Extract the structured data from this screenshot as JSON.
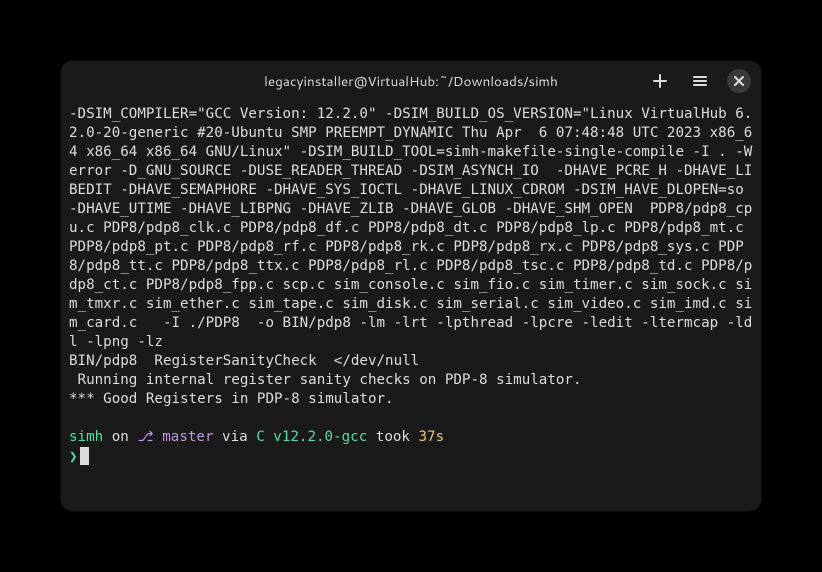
{
  "window": {
    "title": "legacyinstaller@VirtualHub:~/Downloads/simh"
  },
  "output": {
    "compile": "-DSIM_COMPILER=\"GCC Version: 12.2.0\" -DSIM_BUILD_OS_VERSION=\"Linux VirtualHub 6.2.0-20-generic #20-Ubuntu SMP PREEMPT_DYNAMIC Thu Apr  6 07:48:48 UTC 2023 x86_64 x86_64 x86_64 GNU/Linux\" -DSIM_BUILD_TOOL=simh-makefile-single-compile -I . -Werror -D_GNU_SOURCE -DUSE_READER_THREAD -DSIM_ASYNCH_IO  -DHAVE_PCRE_H -DHAVE_LIBEDIT -DHAVE_SEMAPHORE -DHAVE_SYS_IOCTL -DHAVE_LINUX_CDROM -DSIM_HAVE_DLOPEN=so -DHAVE_UTIME -DHAVE_LIBPNG -DHAVE_ZLIB -DHAVE_GLOB -DHAVE_SHM_OPEN  PDP8/pdp8_cpu.c PDP8/pdp8_clk.c PDP8/pdp8_df.c PDP8/pdp8_dt.c PDP8/pdp8_lp.c PDP8/pdp8_mt.c PDP8/pdp8_pt.c PDP8/pdp8_rf.c PDP8/pdp8_rk.c PDP8/pdp8_rx.c PDP8/pdp8_sys.c PDP8/pdp8_tt.c PDP8/pdp8_ttx.c PDP8/pdp8_rl.c PDP8/pdp8_tsc.c PDP8/pdp8_td.c PDP8/pdp8_ct.c PDP8/pdp8_fpp.c scp.c sim_console.c sim_fio.c sim_timer.c sim_sock.c sim_tmxr.c sim_ether.c sim_tape.c sim_disk.c sim_serial.c sim_video.c sim_imd.c sim_card.c   -I ./PDP8  -o BIN/pdp8 -lm -lrt -lpthread -lpcre -ledit -ltermcap -ldl -lpng -lz",
    "sanity1": "BIN/pdp8  RegisterSanityCheck  </dev/null",
    "sanity2": " Running internal register sanity checks on PDP-8 simulator.",
    "sanity3": "*** Good Registers in PDP-8 simulator."
  },
  "prompt": {
    "dir": "simh",
    "on": " on ",
    "branch_icon": "⎇",
    "branch": " master",
    "via": " via ",
    "lang": "C v12.2.0-gcc",
    "took": " took ",
    "time": "37s",
    "caret": "❯"
  }
}
